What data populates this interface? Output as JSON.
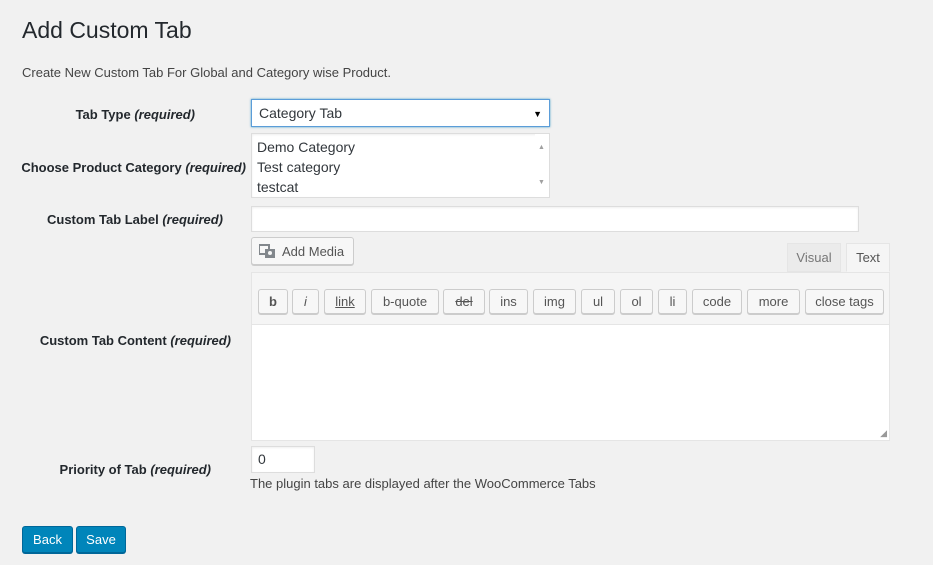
{
  "page": {
    "title": "Add Custom Tab",
    "description": "Create New Custom Tab For Global and Category wise Product."
  },
  "fields": {
    "tab_type": {
      "label": "Tab Type",
      "required": "(required)",
      "value": "Category Tab"
    },
    "product_category": {
      "label": "Choose Product Category",
      "required": "(required)",
      "options": [
        "Demo Category",
        "Test category",
        "testcat"
      ]
    },
    "tab_label": {
      "label": "Custom Tab Label",
      "required": "(required)",
      "value": ""
    },
    "tab_content": {
      "label": "Custom Tab Content",
      "required": "(required)"
    },
    "priority": {
      "label": "Priority of Tab",
      "required": "(required)",
      "value": "0",
      "help": "The plugin tabs are displayed after the WooCommerce Tabs"
    }
  },
  "editor": {
    "add_media": "Add Media",
    "tabs": [
      "Visual",
      "Text"
    ],
    "quicktags": [
      "b",
      "i",
      "link",
      "b-quote",
      "del",
      "ins",
      "img",
      "ul",
      "ol",
      "li",
      "code",
      "more",
      "close tags"
    ]
  },
  "actions": {
    "back": "Back",
    "save": "Save"
  },
  "colors": {
    "primary": "#0085ba",
    "focus": "#5b9dd9"
  },
  "icons": {
    "media": "media-icon",
    "dropdown": "chevron-down-icon"
  }
}
